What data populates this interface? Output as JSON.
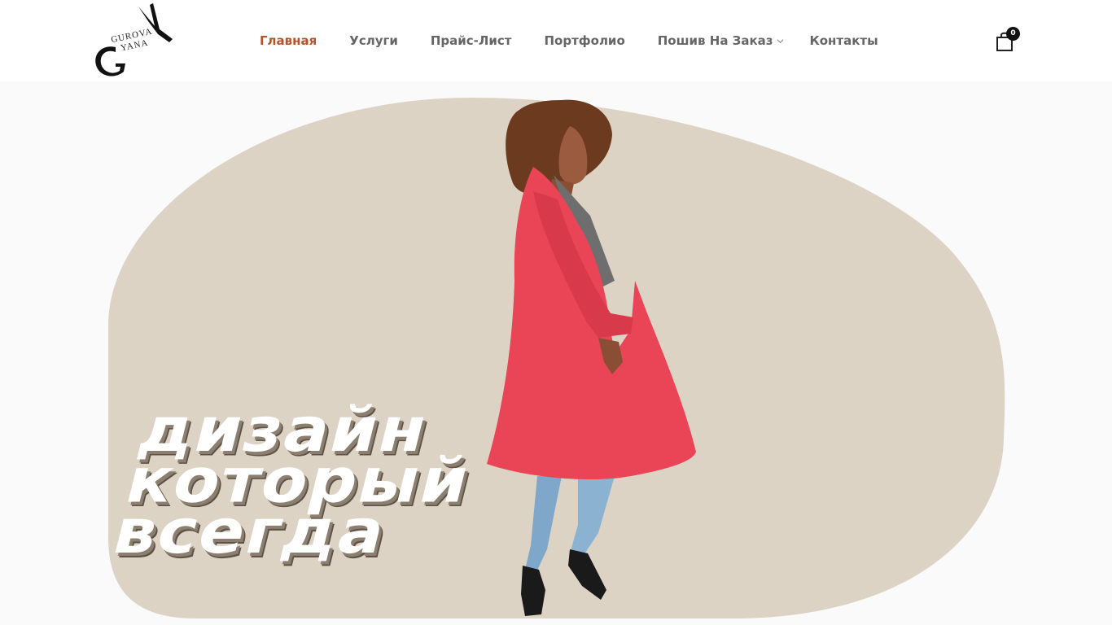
{
  "brand": {
    "logo_line1": "GUROVA",
    "logo_line2": "YANA",
    "monogram_g": "G",
    "monogram_y": "Y"
  },
  "nav": {
    "items": [
      {
        "label": "Главная",
        "active": true
      },
      {
        "label": "Услуги"
      },
      {
        "label": "Прайс-Лист"
      },
      {
        "label": "Портфолио"
      },
      {
        "label": "Пошив На Заказ",
        "has_dropdown": true
      },
      {
        "label": "Контакты"
      }
    ]
  },
  "cart": {
    "count": "0",
    "icon": "shopping-bag-icon"
  },
  "hero": {
    "headline_lines": [
      "дизайн",
      "который",
      "всегда"
    ],
    "blob_color": "#ddd3c5",
    "accent_color": "#b5532b",
    "coat_color": "#e94557"
  }
}
